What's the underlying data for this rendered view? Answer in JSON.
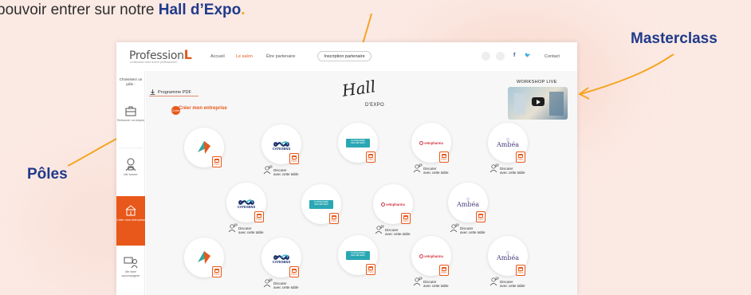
{
  "caption": {
    "prefix": "pouvoir entrer sur notre ",
    "highlight": "Hall d’Expo",
    "suffix": "."
  },
  "callouts": {
    "masterclass": "Masterclass",
    "poles": "Pôles"
  },
  "site": {
    "logo_text": "Profession",
    "logo_letter": "L",
    "logo_tagline": "construisez votre avenir professionnel",
    "nav": [
      "Accueil",
      "Le salon",
      "Être partenaire"
    ],
    "nav_active_index": 1,
    "nav_button": "Inscription partenaire",
    "social": {
      "facebook": "f",
      "twitter": "🐦"
    },
    "contact": "Contact",
    "accent_color": "#e8581a"
  },
  "sidebar": {
    "title": "Choisissez un pôle :",
    "poles": [
      {
        "label": "Retrouver un emploi",
        "icon": "briefcase-icon"
      },
      {
        "label": "Me former",
        "icon": "student-icon"
      },
      {
        "label": "Créer mon entreprise",
        "icon": "building-icon",
        "active": true
      },
      {
        "label": "Me faire accompagner",
        "icon": "advisor-icon"
      }
    ]
  },
  "main": {
    "programme_pdf": "Programme PDF",
    "create_badge": "Créer",
    "create_label": "Créer mon entreprise",
    "hall_script": "Hall",
    "hall_expo": "D'EXPO",
    "workshop_title": "WORKSHOP LIVE",
    "rdv_label": "RDV",
    "discuss_label": [
      "Discuter",
      "avec cette table"
    ],
    "brands": {
      "catesens": "CATESENS",
      "teal_line1": "PLATEFORME",
      "teal_line2": "DES MÉTIERS",
      "vet": "vetopharma",
      "ambea": "Ambéa",
      "ambea_sub": "®"
    }
  }
}
